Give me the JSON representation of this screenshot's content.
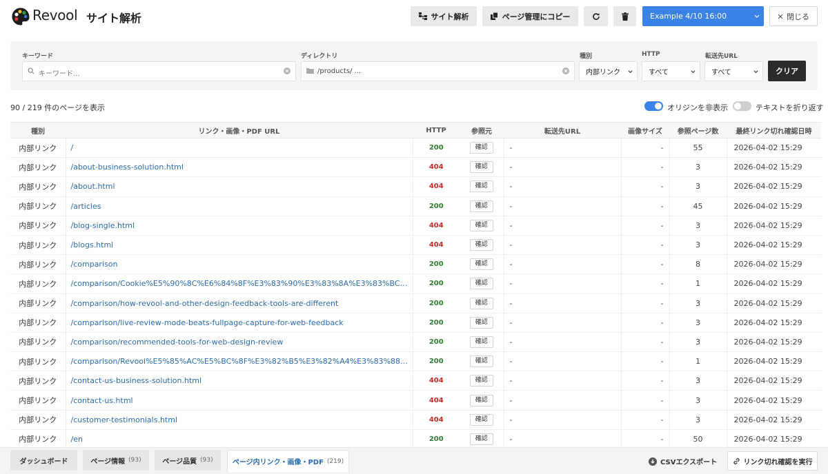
{
  "header": {
    "app_name": "Revool",
    "page_title": "サイト解析",
    "site_analysis_label": "サイト解析",
    "copy_label": "ページ管理にコピー",
    "snapshot_selected": "Example 4/10 16:00",
    "close_label": "閉じる"
  },
  "filters": {
    "keyword_label": "キーワード",
    "keyword_placeholder": "キーワード...",
    "directory_label": "ディレクトリ",
    "directory_value": "/products/ ...",
    "kind_label": "種別",
    "kind_value": "内部リンク",
    "http_label": "HTTP",
    "http_value": "すべて",
    "redirect_label": "転送先URL",
    "redirect_value": "すべて",
    "clear_label": "クリア"
  },
  "summary": {
    "count_text": "90 / 219 件のページを表示",
    "hide_origin_label": "オリジンを非表示",
    "hide_origin_on": true,
    "wrap_text_label": "テキストを折り返す",
    "wrap_text_on": false
  },
  "table": {
    "headers": [
      "種別",
      "リンク・画像・PDF URL",
      "HTTP",
      "参照元",
      "転送先URL",
      "画像サイズ",
      "参照ページ数",
      "最終リンク切れ確認日時"
    ],
    "confirm_label": "確認",
    "rows": [
      {
        "kind": "内部リンク",
        "url": "/",
        "http": "200",
        "redirect": "-",
        "img": "-",
        "pages": "55",
        "date": "2026-04-02 15:29"
      },
      {
        "kind": "内部リンク",
        "url": "/about-business-solution.html",
        "http": "404",
        "redirect": "-",
        "img": "-",
        "pages": "3",
        "date": "2026-04-02 15:29"
      },
      {
        "kind": "内部リンク",
        "url": "/about.html",
        "http": "404",
        "redirect": "-",
        "img": "-",
        "pages": "3",
        "date": "2026-04-02 15:29"
      },
      {
        "kind": "内部リンク",
        "url": "/articles",
        "http": "200",
        "redirect": "-",
        "img": "-",
        "pages": "45",
        "date": "2026-04-02 15:29"
      },
      {
        "kind": "内部リンク",
        "url": "/blog-single.html",
        "http": "404",
        "redirect": "-",
        "img": "-",
        "pages": "3",
        "date": "2026-04-02 15:29"
      },
      {
        "kind": "内部リンク",
        "url": "/blogs.html",
        "http": "404",
        "redirect": "-",
        "img": "-",
        "pages": "3",
        "date": "2026-04-02 15:29"
      },
      {
        "kind": "内部リンク",
        "url": "/comparison",
        "http": "200",
        "redirect": "-",
        "img": "-",
        "pages": "8",
        "date": "2026-04-02 15:29"
      },
      {
        "kind": "内部リンク",
        "url": "/comparison/Cookie%E5%90%8C%E6%84%8F%E3%83%90%E3%83%8A%E3%83%BC%E7%A…",
        "http": "200",
        "redirect": "-",
        "img": "-",
        "pages": "1",
        "date": "2026-04-02 15:29"
      },
      {
        "kind": "内部リンク",
        "url": "/comparison/how-revool-and-other-design-feedback-tools-are-different",
        "http": "200",
        "redirect": "-",
        "img": "-",
        "pages": "3",
        "date": "2026-04-02 15:29"
      },
      {
        "kind": "内部リンク",
        "url": "/comparison/live-review-mode-beats-fullpage-capture-for-web-feedback",
        "http": "200",
        "redirect": "-",
        "img": "-",
        "pages": "3",
        "date": "2026-04-02 15:29"
      },
      {
        "kind": "内部リンク",
        "url": "/comparison/recommended-tools-for-web-design-review",
        "http": "200",
        "redirect": "-",
        "img": "-",
        "pages": "3",
        "date": "2026-04-02 15:29"
      },
      {
        "kind": "内部リンク",
        "url": "/comparison/Revool%E5%85%AC%E5%BC%8F%E3%82%B5%E3%82%A4%E3%83%88%E3%8…",
        "http": "200",
        "redirect": "-",
        "img": "-",
        "pages": "1",
        "date": "2026-04-02 15:29"
      },
      {
        "kind": "内部リンク",
        "url": "/contact-us-business-solution.html",
        "http": "404",
        "redirect": "-",
        "img": "-",
        "pages": "3",
        "date": "2026-04-02 15:29"
      },
      {
        "kind": "内部リンク",
        "url": "/contact-us.html",
        "http": "404",
        "redirect": "-",
        "img": "-",
        "pages": "3",
        "date": "2026-04-02 15:29"
      },
      {
        "kind": "内部リンク",
        "url": "/customer-testimonials.html",
        "http": "404",
        "redirect": "-",
        "img": "-",
        "pages": "3",
        "date": "2026-04-02 15:29"
      },
      {
        "kind": "内部リンク",
        "url": "/en",
        "http": "200",
        "redirect": "-",
        "img": "-",
        "pages": "50",
        "date": "2026-04-02 15:29"
      }
    ]
  },
  "bottom": {
    "tabs": [
      {
        "label": "ダッシュボード",
        "count": ""
      },
      {
        "label": "ページ情報",
        "count": "(93)"
      },
      {
        "label": "ページ品質",
        "count": "(93)"
      },
      {
        "label": "ページ内リンク・画像・PDF",
        "count": "(219)"
      }
    ],
    "csv_label": "CSVエクスポート",
    "run_label": "リンク切れ確認を実行"
  },
  "colors": {
    "accent": "#3b82e6",
    "status_ok": "#2e7d32",
    "status_error": "#c62828",
    "link": "#2b6cb0"
  }
}
